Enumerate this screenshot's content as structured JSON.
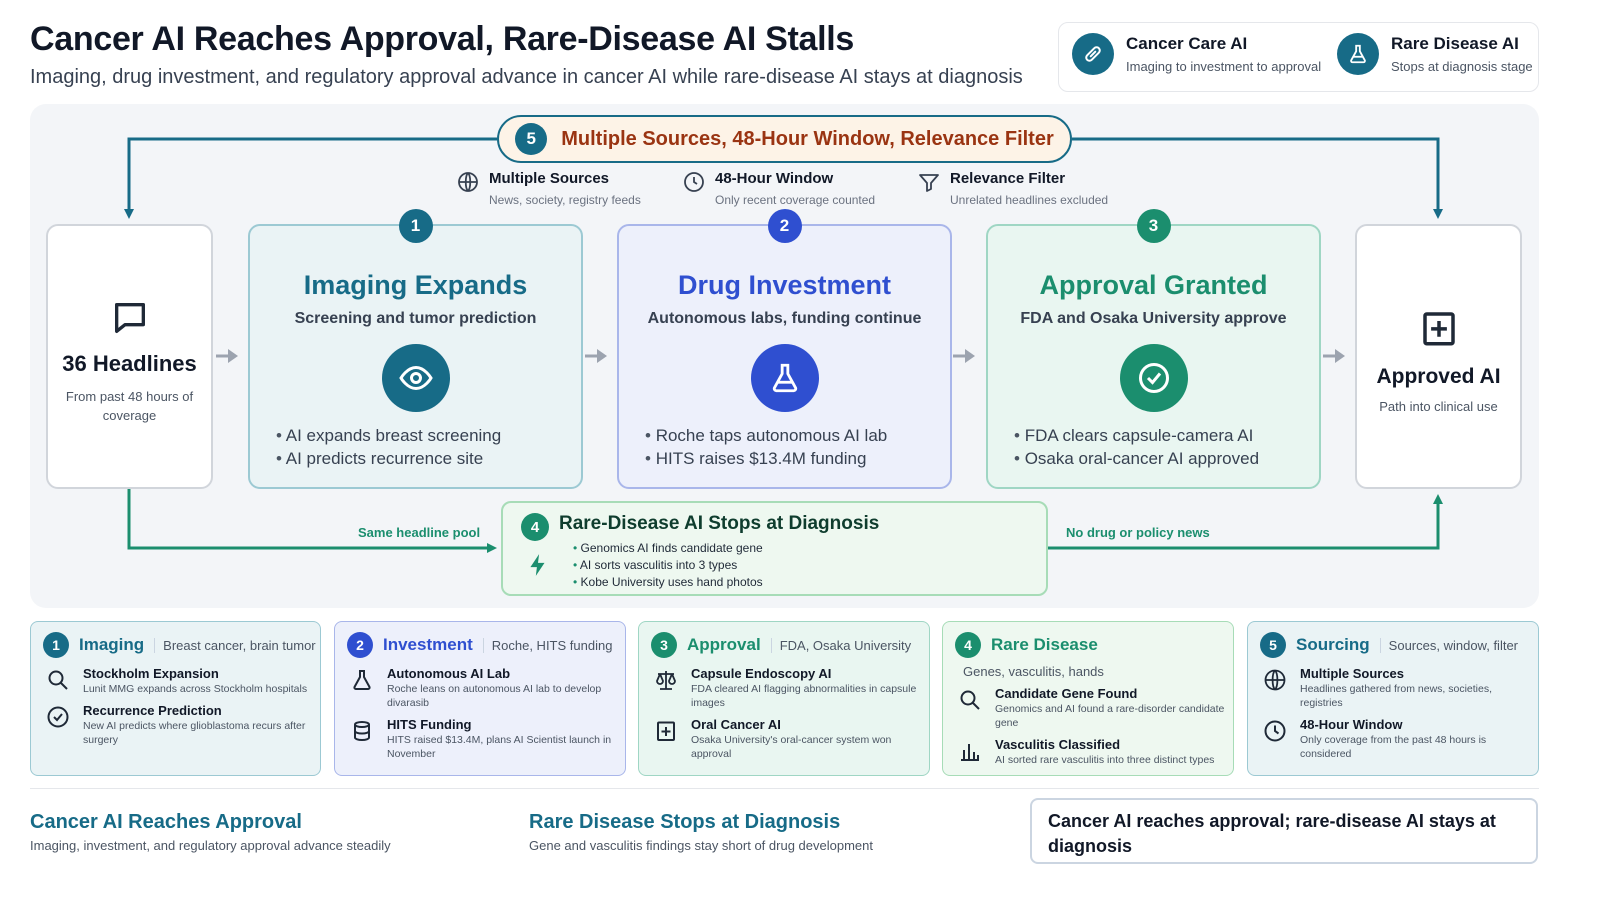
{
  "header": {
    "title": "Cancer AI Reaches Approval, Rare-Disease AI Stalls",
    "subtitle": "Imaging, drug investment, and regulatory approval advance in cancer AI while rare-disease AI stays at diagnosis"
  },
  "legend": {
    "cancer": {
      "title": "Cancer Care AI",
      "sub": "Imaging to investment to approval",
      "icon": "link-icon"
    },
    "rare": {
      "title": "Rare Disease AI",
      "sub": "Stops at diagnosis stage",
      "icon": "flask-icon"
    }
  },
  "sourcing": {
    "num": "5",
    "title": "Multiple Sources, 48-Hour Window, Relevance Filter",
    "items": [
      {
        "title": "Multiple Sources",
        "sub": "News, society, registry feeds",
        "icon": "globe-icon"
      },
      {
        "title": "48-Hour Window",
        "sub": "Only recent coverage counted",
        "icon": "clock-icon"
      },
      {
        "title": "Relevance Filter",
        "sub": "Unrelated headlines excluded",
        "icon": "filter-icon"
      }
    ]
  },
  "headlines": {
    "title": "36 Headlines",
    "sub": "From past 48 hours of coverage",
    "icon": "chat-icon"
  },
  "stages": [
    {
      "num": "1",
      "title": "Imaging Expands",
      "sub": "Screening and tumor prediction",
      "icon": "eye-icon",
      "bullets": [
        "AI expands breast screening",
        "AI predicts recurrence site"
      ]
    },
    {
      "num": "2",
      "title": "Drug Investment",
      "sub": "Autonomous labs, funding continue",
      "icon": "flask-icon",
      "bullets": [
        "Roche taps autonomous AI lab",
        "HITS raises $13.4M funding"
      ]
    },
    {
      "num": "3",
      "title": "Approval Granted",
      "sub": "FDA and Osaka University approve",
      "icon": "check-icon",
      "bullets": [
        "FDA clears capsule-camera AI",
        "Osaka oral-cancer AI approved"
      ]
    }
  ],
  "approved": {
    "title": "Approved AI",
    "sub": "Path into clinical use",
    "icon": "medical-plus-icon"
  },
  "rare_box": {
    "num": "4",
    "title": "Rare-Disease AI Stops at Diagnosis",
    "icon": "bolt-icon",
    "bullets": [
      "Genomics AI finds candidate gene",
      "AI sorts vasculitis into 3 types",
      "Kobe University uses hand photos"
    ]
  },
  "flow_labels": {
    "left": "Same headline pool",
    "right": "No drug or policy news"
  },
  "cards": [
    {
      "num": "1",
      "title": "Imaging",
      "tag": "Breast cancer, brain tumor",
      "entries": [
        {
          "title": "Stockholm Expansion",
          "desc": "Lunit MMG expands across Stockholm hospitals",
          "icon": "search-icon"
        },
        {
          "title": "Recurrence Prediction",
          "desc": "New AI predicts where glioblastoma recurs after surgery",
          "icon": "check-circle-icon"
        }
      ]
    },
    {
      "num": "2",
      "title": "Investment",
      "tag": "Roche, HITS funding",
      "entries": [
        {
          "title": "Autonomous AI Lab",
          "desc": "Roche leans on autonomous AI lab to develop divarasib",
          "icon": "flask-icon"
        },
        {
          "title": "HITS Funding",
          "desc": "HITS raised $13.4M, plans AI Scientist launch in November",
          "icon": "database-icon"
        }
      ]
    },
    {
      "num": "3",
      "title": "Approval",
      "tag": "FDA, Osaka University",
      "entries": [
        {
          "title": "Capsule Endoscopy AI",
          "desc": "FDA cleared AI flagging abnormalities in capsule images",
          "icon": "scales-icon"
        },
        {
          "title": "Oral Cancer AI",
          "desc": "Osaka University's oral-cancer system won approval",
          "icon": "medical-plus-icon"
        }
      ]
    },
    {
      "num": "4",
      "title": "Rare Disease",
      "tag": "Genes, vasculitis, hands",
      "entries": [
        {
          "title": "Candidate Gene Found",
          "desc": "Genomics and AI found a rare-disorder candidate gene",
          "icon": "search-icon"
        },
        {
          "title": "Vasculitis Classified",
          "desc": "AI sorted rare vasculitis into three distinct types",
          "icon": "bar-chart-icon"
        }
      ]
    },
    {
      "num": "5",
      "title": "Sourcing",
      "tag": "Sources, window, filter",
      "entries": [
        {
          "title": "Multiple Sources",
          "desc": "Headlines gathered from news, societies, registries",
          "icon": "globe-icon"
        },
        {
          "title": "48-Hour Window",
          "desc": "Only coverage from the past 48 hours is considered",
          "icon": "clock-icon"
        }
      ]
    }
  ],
  "footer": {
    "left_title": "Cancer AI Reaches Approval",
    "left_sub": "Imaging, investment, and regulatory approval advance steadily",
    "mid_title": "Rare Disease Stops at Diagnosis",
    "mid_sub": "Gene and vasculitis findings stay short of drug development",
    "conclusion": "Cancer AI reaches approval; rare-disease AI stays at diagnosis"
  },
  "colors": {
    "teal": "#176b87",
    "blue": "#2f4fd0",
    "green": "#1b8e6e",
    "orange": "#9a3412",
    "arrow_gray": "#9ca3af"
  }
}
